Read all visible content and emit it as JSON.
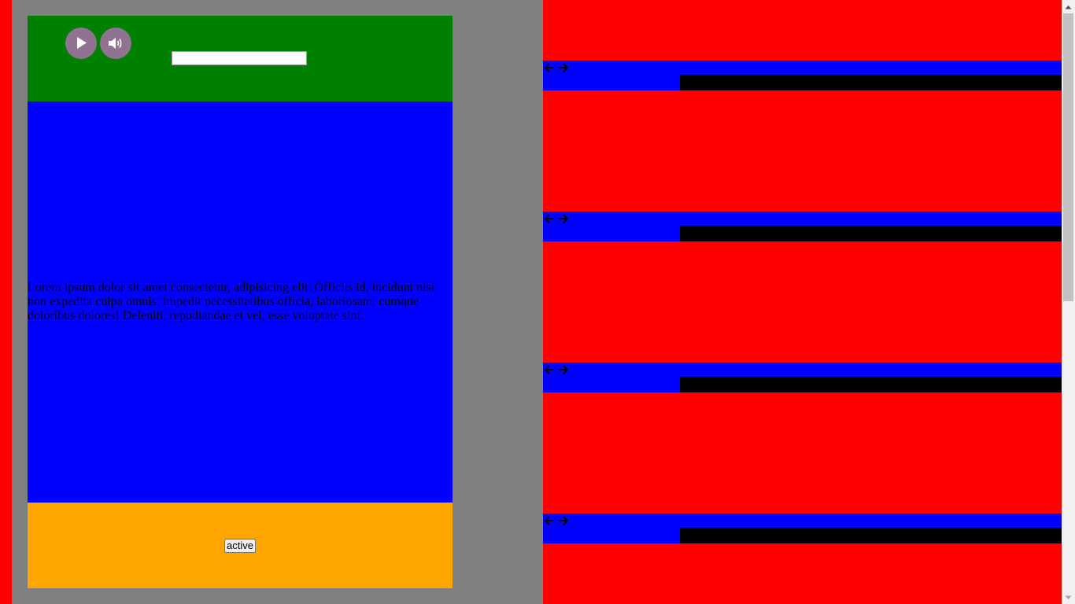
{
  "player": {
    "play_icon": "play-icon",
    "volume_icon": "volume-icon",
    "input_value": ""
  },
  "content": {
    "paragraph": "Lorem ipsum dolor sit amet consectetur, adipisicing elit. Officiis id, incidunt nisi non expedita culpa omnis, impedit necessitatibus officia, laboriosam, cumque doloribus dolores! Deleniti, repudiandae et vel, esse voluptate sint."
  },
  "footer": {
    "button_label": "active"
  },
  "strips": [
    {
      "prev_icon": "arrow-left-icon",
      "next_icon": "arrow-right-icon"
    },
    {
      "prev_icon": "arrow-left-icon",
      "next_icon": "arrow-right-icon"
    },
    {
      "prev_icon": "arrow-left-icon",
      "next_icon": "arrow-right-icon"
    },
    {
      "prev_icon": "arrow-left-icon",
      "next_icon": "arrow-right-icon"
    }
  ],
  "colors": {
    "background": "#ff0000",
    "panel": "#808080",
    "header": "#008000",
    "body": "#0000ff",
    "footer": "#ffa500",
    "round_button": "#8f7391",
    "bar": "#000000"
  }
}
